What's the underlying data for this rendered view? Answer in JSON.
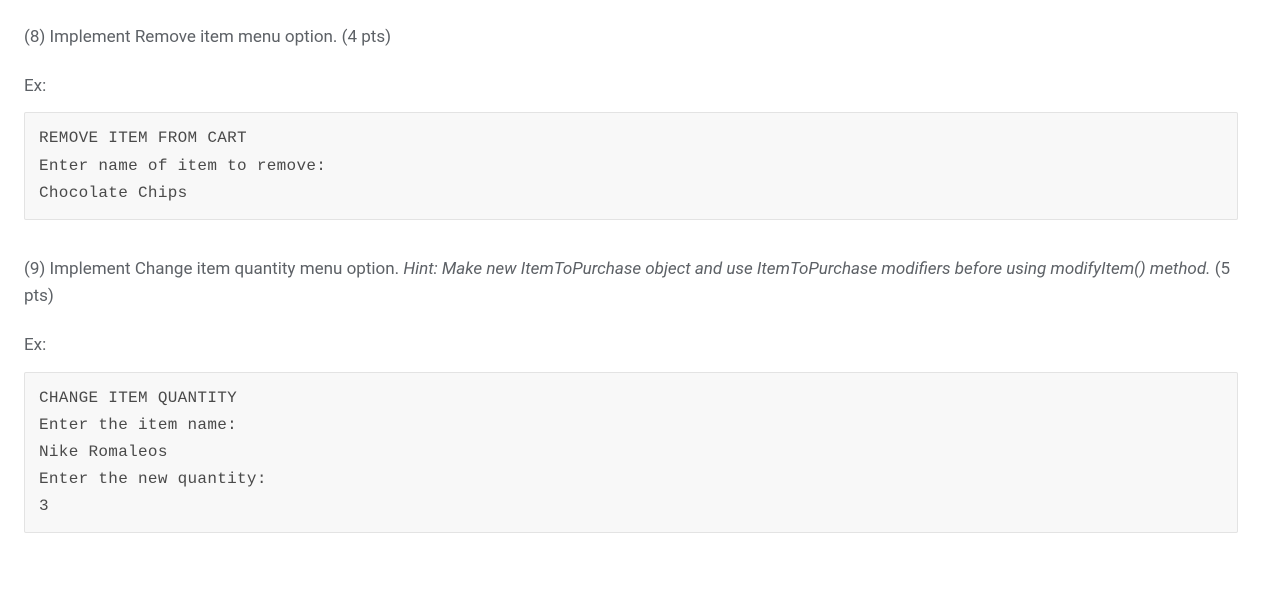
{
  "section8": {
    "number": "(8)",
    "title": "Implement Remove item menu option.",
    "points": "(4 pts)",
    "ex_label": "Ex:",
    "code": "REMOVE ITEM FROM CART\nEnter name of item to remove:\nChocolate Chips"
  },
  "section9": {
    "number": "(9)",
    "title_before_hint": "Implement Change item quantity menu option.",
    "hint": "Hint: Make new ItemToPurchase object and use ItemToPurchase modifiers before using modifyItem() method.",
    "points": "(5 pts)",
    "ex_label": "Ex:",
    "code": "CHANGE ITEM QUANTITY\nEnter the item name:\nNike Romaleos\nEnter the new quantity:\n3"
  }
}
